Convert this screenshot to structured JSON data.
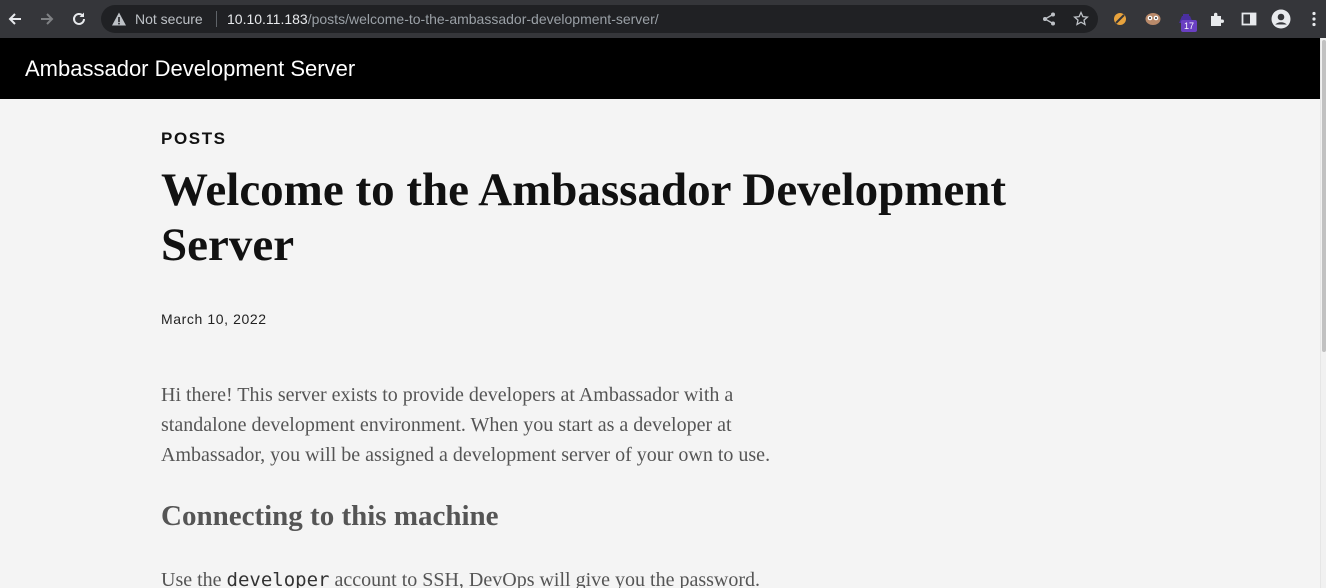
{
  "browser": {
    "security_label": "Not secure",
    "url_host": "10.10.11.183",
    "url_path": "/posts/welcome-to-the-ambassador-development-server/",
    "extension_badge": "17",
    "accent": "#6a3fc2"
  },
  "site": {
    "title": "Ambassador Development Server"
  },
  "post": {
    "category": "POSTS",
    "title": "Welcome to the Ambassador Development Server",
    "date": "March 10, 2022",
    "intro": "Hi there! This server exists to provide developers at Ambassador with a standalone development environment. When you start as a developer at Ambassador, you will be assigned a development server of your own to use.",
    "section_heading": "Connecting to this machine",
    "ssh_before": "Use the ",
    "ssh_code": "developer",
    "ssh_after": " account to SSH, DevOps will give you the password."
  }
}
